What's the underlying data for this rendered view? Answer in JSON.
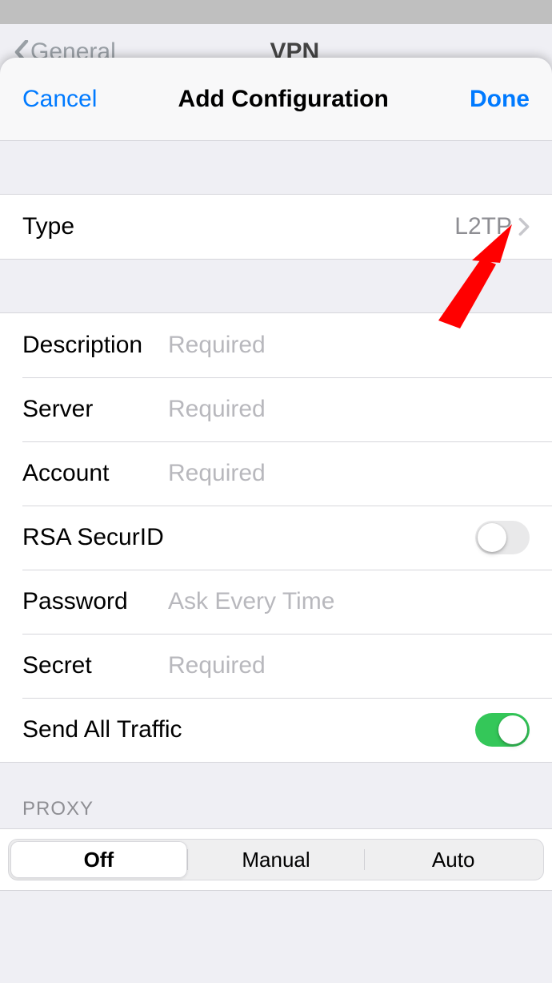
{
  "background": {
    "back_label": "General",
    "title": "VPN"
  },
  "nav": {
    "cancel": "Cancel",
    "title": "Add Configuration",
    "done": "Done"
  },
  "type_row": {
    "label": "Type",
    "value": "L2TP"
  },
  "fields": {
    "description": {
      "label": "Description",
      "placeholder": "Required",
      "value": ""
    },
    "server": {
      "label": "Server",
      "placeholder": "Required",
      "value": ""
    },
    "account": {
      "label": "Account",
      "placeholder": "Required",
      "value": ""
    },
    "rsa": {
      "label": "RSA SecurID",
      "on": false
    },
    "password": {
      "label": "Password",
      "placeholder": "Ask Every Time",
      "value": ""
    },
    "secret": {
      "label": "Secret",
      "placeholder": "Required",
      "value": ""
    },
    "send_all": {
      "label": "Send All Traffic",
      "on": true
    }
  },
  "proxy": {
    "header": "PROXY",
    "options": [
      "Off",
      "Manual",
      "Auto"
    ],
    "selected_index": 0
  },
  "annotation": {
    "arrow_color": "#ff0000"
  }
}
